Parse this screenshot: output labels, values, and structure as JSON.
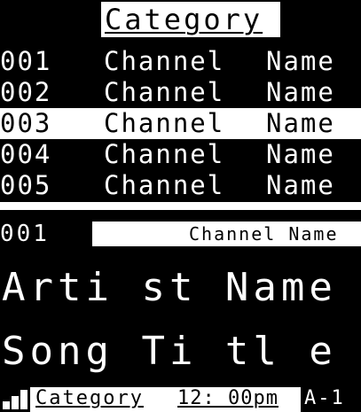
{
  "channel_list": {
    "category": "Category",
    "rows": [
      {
        "number": "001",
        "channel": "Channel",
        "name": "Name",
        "selected": false
      },
      {
        "number": "002",
        "channel": "Channel",
        "name": "Name",
        "selected": false
      },
      {
        "number": "003",
        "channel": "Channel",
        "name": "Name",
        "selected": true
      },
      {
        "number": "004",
        "channel": "Channel",
        "name": "Name",
        "selected": false
      },
      {
        "number": "005",
        "channel": "Channel",
        "name": "Name",
        "selected": false
      }
    ]
  },
  "now_playing": {
    "channel_number": "001",
    "channel_name": "Channel Name",
    "artist": "Arti st Name",
    "song": "Song Ti tl e"
  },
  "status_bar": {
    "signal_icon": "signal-strength-icon",
    "signal_bars_shown": 3,
    "category": "Category",
    "time": "12: 00pm",
    "preset": "A-1"
  },
  "colors": {
    "background": "#000000",
    "foreground": "#ffffff",
    "highlight": "#ffffff"
  }
}
